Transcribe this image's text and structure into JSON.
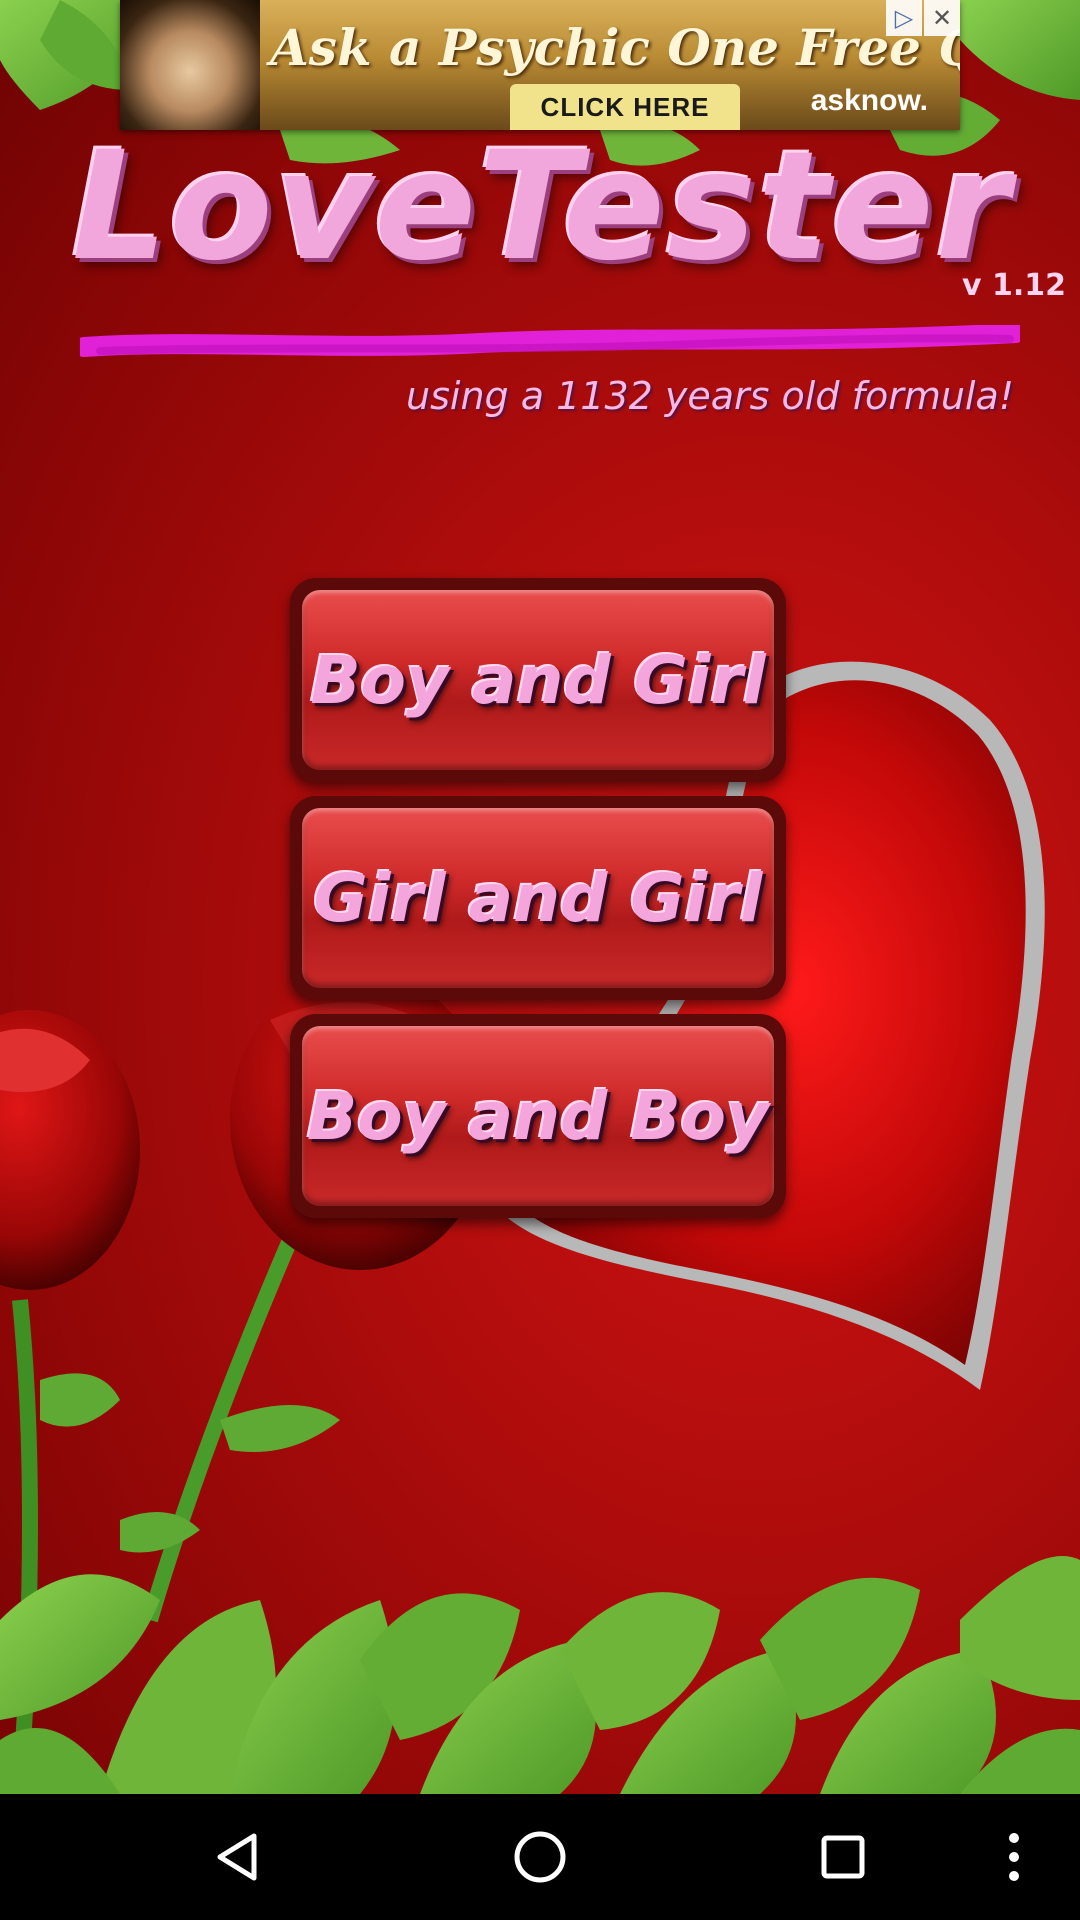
{
  "ad": {
    "headline": "Ask a Psychic One Free Question",
    "cta": "CLICK HERE",
    "brand": "asknow."
  },
  "header": {
    "title": "LoveTester",
    "version": "v 1.12",
    "subtitle": "using a 1132 years old formula!"
  },
  "menu": {
    "items": [
      {
        "label": "Boy and Girl"
      },
      {
        "label": "Girl and Girl"
      },
      {
        "label": "Boy and Boy"
      }
    ]
  },
  "colors": {
    "background": "#b30d0d",
    "title": "#f2a7dc",
    "button": "#cf2a2a",
    "leaf": "#6fb53a"
  },
  "navbar": {
    "buttons": [
      "back-icon",
      "home-icon",
      "recents-icon",
      "menu-icon"
    ]
  }
}
